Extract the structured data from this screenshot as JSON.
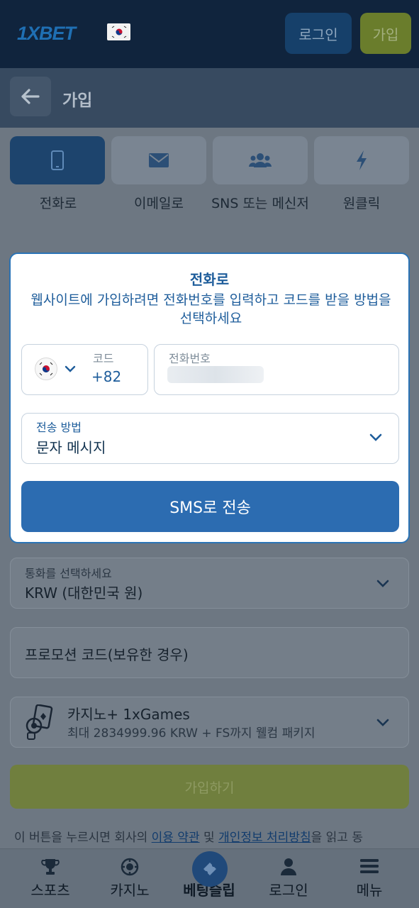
{
  "header": {
    "logo": "1XBET",
    "login_label": "로그인",
    "join_label": "가입"
  },
  "subheader": {
    "title": "가입"
  },
  "tabs": [
    {
      "label": "전화로",
      "icon": "phone-icon",
      "active": true
    },
    {
      "label": "이메일로",
      "icon": "envelope-icon",
      "active": false
    },
    {
      "label": "SNS 또는 메신저",
      "icon": "users-icon",
      "active": false
    },
    {
      "label": "원클릭",
      "icon": "lightning-icon",
      "active": false
    }
  ],
  "modal": {
    "title": "전화로",
    "description": "웹사이트에 가입하려면 전화번호를 입력하고 코드를 받을 방법을 선택하세요",
    "code_label": "코드",
    "code_value": "+82",
    "phone_label": "전화번호",
    "method_label": "전송 방법",
    "method_value": "문자 메시지",
    "send_button": "SMS로 전송"
  },
  "form": {
    "currency_label": "통화를 선택하세요",
    "currency_value": "KRW (대한민국 원)",
    "promo_placeholder": "프로모션 코드(보유한 경우)",
    "bonus_title": "카지노+ 1xGames",
    "bonus_sub": "최대 2834999.96 KRW + FS까지 웰컴 패키지",
    "signup_button": "가입하기",
    "terms_pre": "이 버튼을 누르시면 회사의 ",
    "terms_link1": "이용 약관",
    "terms_mid": " 및 ",
    "terms_link2": "개인정보 처리방침",
    "terms_post": "을 읽고 동"
  },
  "bottom_nav": [
    {
      "label": "스포츠",
      "icon": "trophy-icon"
    },
    {
      "label": "카지노",
      "icon": "casino-chip-icon"
    },
    {
      "label": "베팅슬립",
      "icon": "ticket-icon"
    },
    {
      "label": "로그인",
      "icon": "user-icon"
    },
    {
      "label": "메뉴",
      "icon": "menu-icon"
    }
  ],
  "colors": {
    "accent": "#2c6cb1",
    "header_bg": "#10243d",
    "join_green": "#6a7d2c"
  }
}
